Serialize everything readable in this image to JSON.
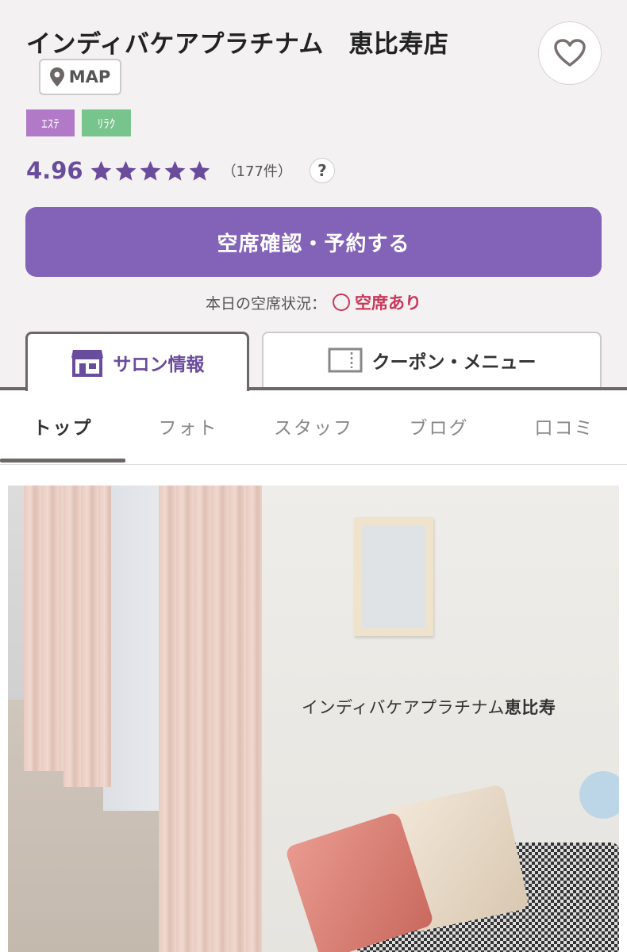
{
  "salon": {
    "name": "インディバケアプラチナム　恵比寿店",
    "map_label": "MAP",
    "tags": [
      "ｴｽﾃ",
      "ﾘﾗｸ"
    ]
  },
  "rating": {
    "score": "4.96",
    "stars_value": 4.96,
    "stars_max": 5,
    "count": "（177件）",
    "help_label": "?"
  },
  "reserve": {
    "button_label": "空席確認・予約する",
    "availability_label": "本日の空席状況：",
    "availability_status": "空席あり"
  },
  "main_tabs": [
    {
      "label": "サロン情報",
      "icon": "storefront-icon",
      "active": true
    },
    {
      "label": "クーポン・メニュー",
      "icon": "coupon-icon",
      "active": false
    }
  ],
  "sub_nav": [
    {
      "label": "トップ",
      "active": true
    },
    {
      "label": "フォト",
      "active": false
    },
    {
      "label": "スタッフ",
      "active": false
    },
    {
      "label": "ブログ",
      "active": false
    },
    {
      "label": "口コミ",
      "active": false
    }
  ],
  "photo": {
    "caption_main": "インディバケアプラチナム",
    "caption_bold": "恵比寿"
  },
  "colors": {
    "accent_purple": "#8363b8",
    "score_purple": "#6a4c9c",
    "status_red": "#c8385a",
    "tag_este": "#b279c8",
    "tag_relax": "#77c48d"
  }
}
